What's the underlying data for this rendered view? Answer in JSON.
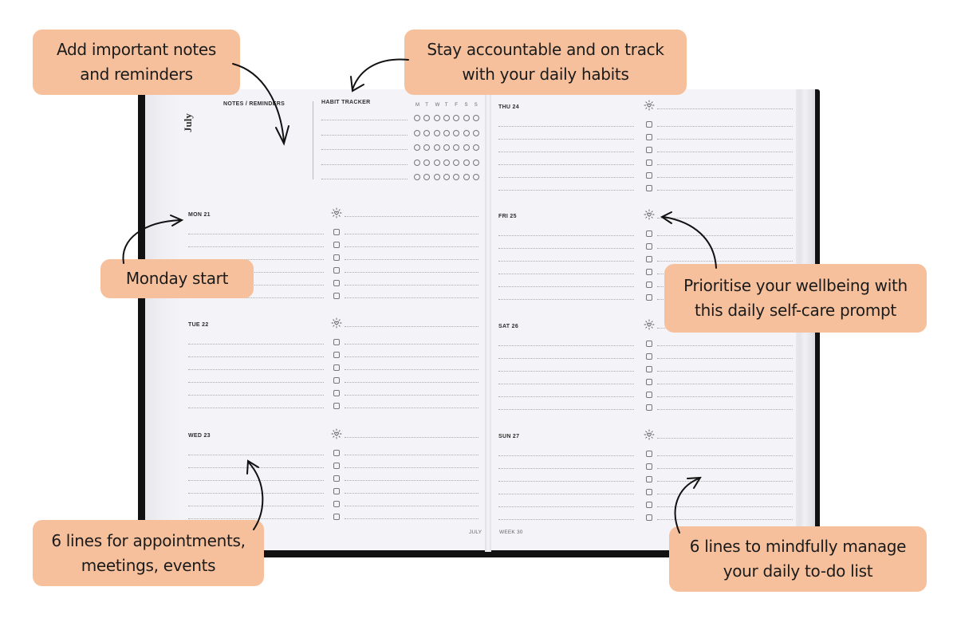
{
  "planner": {
    "month_label": "July",
    "notes_heading": "NOTES / REMINDERS",
    "habit_tracker": {
      "heading": "HABIT TRACKER",
      "weekdays": [
        "M",
        "T",
        "W",
        "T",
        "F",
        "S",
        "S"
      ],
      "rows": 5
    },
    "left_page_days": [
      {
        "label": "MON 21"
      },
      {
        "label": "TUE 22"
      },
      {
        "label": "WED 23"
      }
    ],
    "right_page_days": [
      {
        "label": "THU 24"
      },
      {
        "label": "FRI 25"
      },
      {
        "label": "SAT 26"
      },
      {
        "label": "SUN 27"
      }
    ],
    "lines_per_day": 6,
    "todo_checkboxes_per_day": 6,
    "self_care_icon": "sun-heart-icon",
    "footer_left": "JULY",
    "footer_right": "WEEK 30"
  },
  "callouts": {
    "notes": "Add important notes and reminders",
    "habits": "Stay accountable and on track with your daily habits",
    "monday": "Monday start",
    "selfcare": "Prioritise your wellbeing with this daily self-care prompt",
    "appointments": "6 lines for appointments, meetings, events",
    "todo": "6 lines to mindfully manage your daily to-do list"
  },
  "colors": {
    "callout_bg": "#f6c09c",
    "book_cover": "#111111",
    "page": "#f4f3f7"
  }
}
